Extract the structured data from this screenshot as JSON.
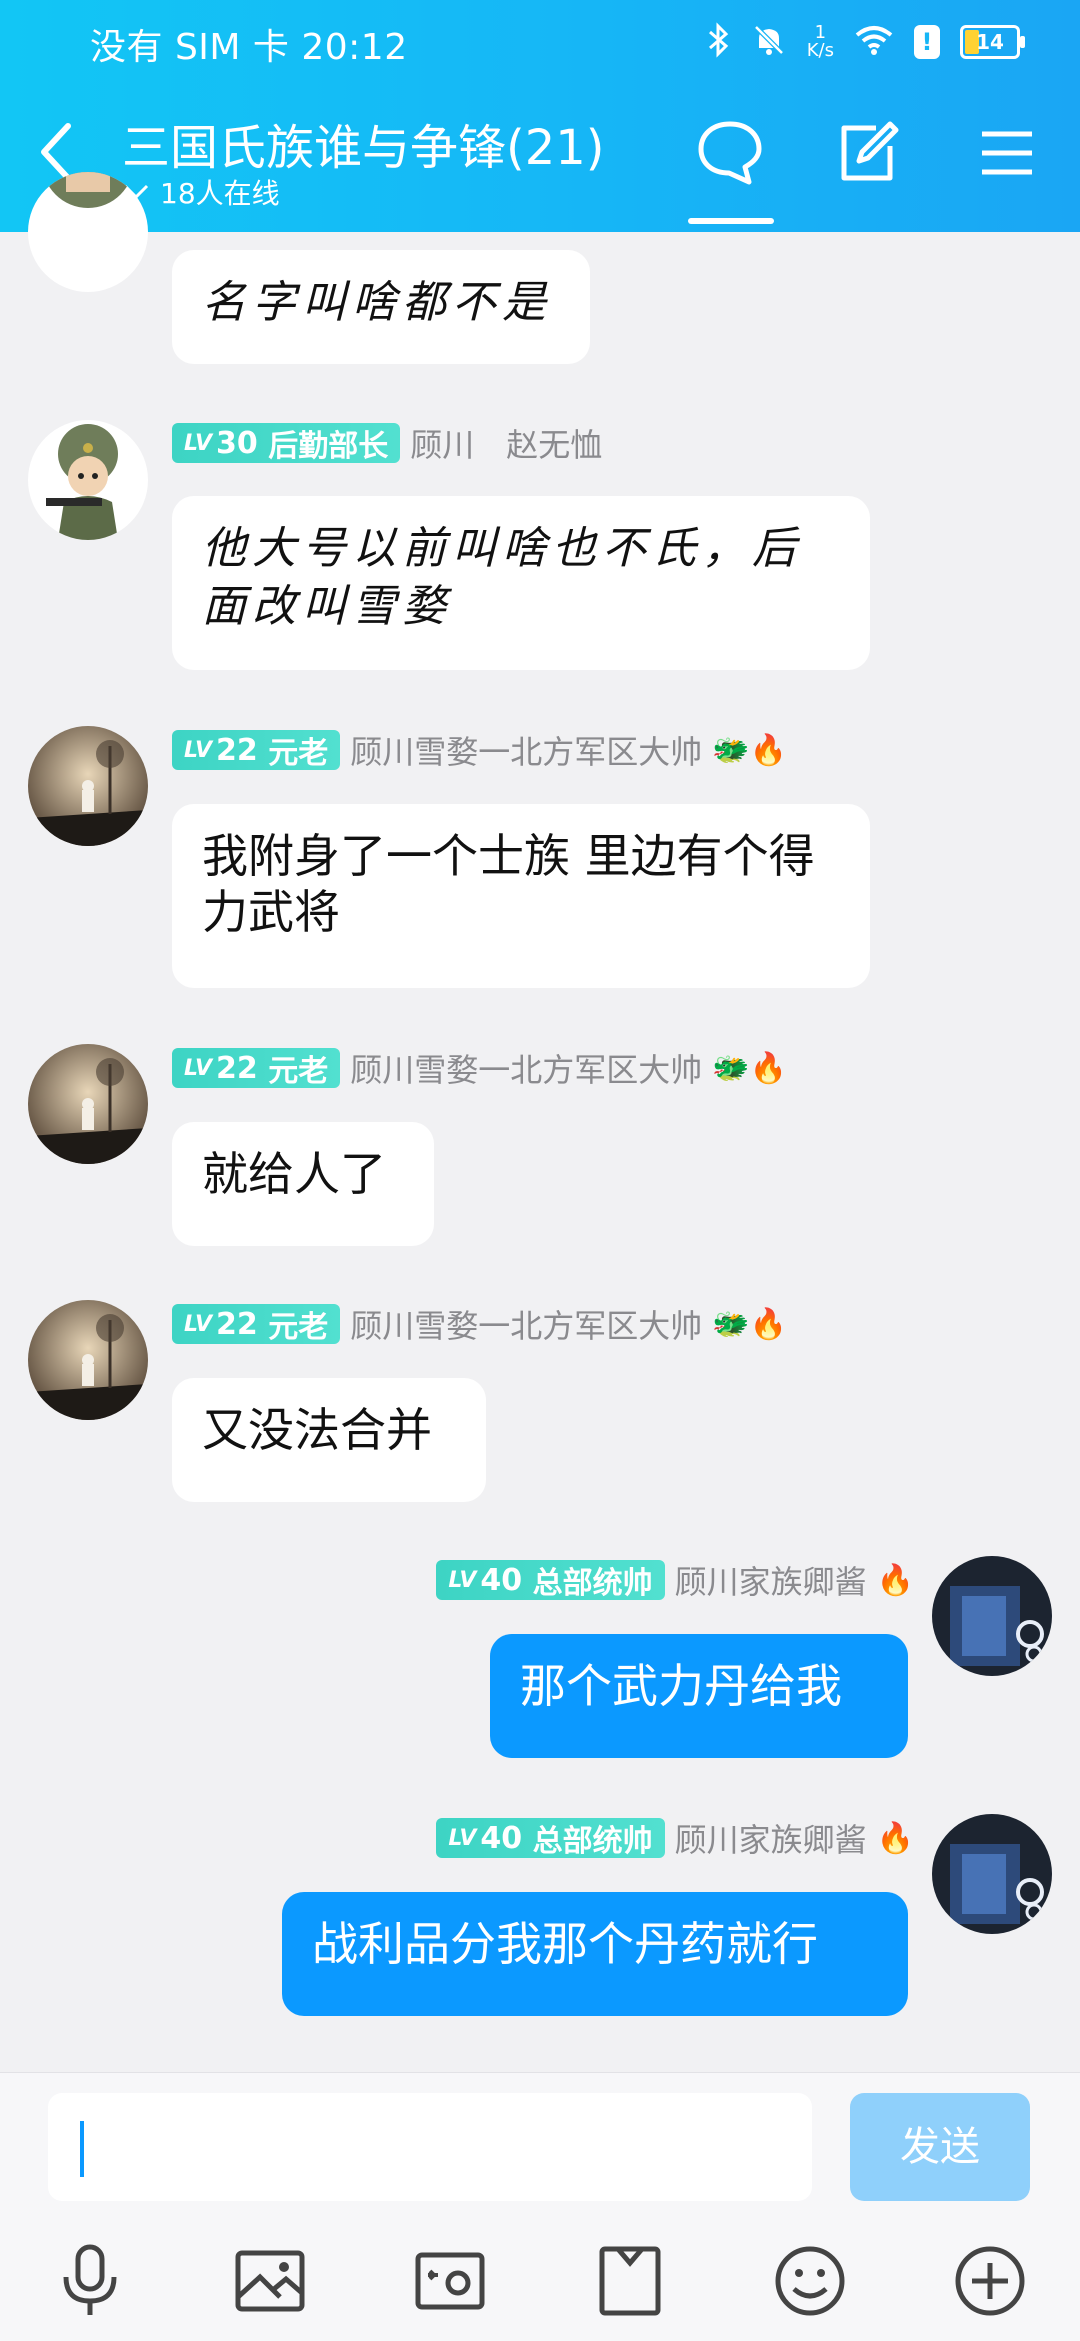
{
  "status_bar": {
    "carrier_time": "没有 SIM 卡 20:12",
    "net_speed_value": "1",
    "net_speed_unit": "K/s",
    "battery": "14",
    "icons": [
      "bluetooth-icon",
      "mute-icon",
      "wifi-icon",
      "alert-icon",
      "battery-icon"
    ]
  },
  "header": {
    "title": "三国氏族谁与争锋(21)",
    "subtitle": "18人在线",
    "icons": [
      "back-icon",
      "chat-bubble-icon",
      "edit-icon",
      "menu-icon"
    ]
  },
  "messages": [
    {
      "side": "left",
      "text": "名字叫啥都不是",
      "handwritten": true
    },
    {
      "side": "left",
      "level": "30",
      "title": "后勤部长",
      "sender": "顾川　赵无恤",
      "text": "他大号以前叫啥也不氏，后面改叫雪婺",
      "handwritten": true
    },
    {
      "side": "left",
      "level": "22",
      "title": "元老",
      "sender": "顾川雪婺一北方军区大帅",
      "emojis": "🐲🔥",
      "text": "我附身了一个士族 里边有个得力武将"
    },
    {
      "side": "left",
      "level": "22",
      "title": "元老",
      "sender": "顾川雪婺一北方军区大帅",
      "emojis": "🐲🔥",
      "text": "就给人了"
    },
    {
      "side": "left",
      "level": "22",
      "title": "元老",
      "sender": "顾川雪婺一北方军区大帅",
      "emojis": "🐲🔥",
      "text": "又没法合并"
    },
    {
      "side": "right",
      "level": "40",
      "title": "总部统帅",
      "sender": "顾川家族卿酱",
      "emojis": "🔥",
      "text": "那个武力丹给我"
    },
    {
      "side": "right",
      "level": "40",
      "title": "总部统帅",
      "sender": "顾川家族卿酱",
      "emojis": "🔥",
      "text": "战利品分我那个丹药就行"
    }
  ],
  "input_bar": {
    "placeholder": "",
    "send_label": "发送",
    "tools": [
      "microphone-icon",
      "image-icon",
      "camera-icon",
      "file-icon",
      "emoji-icon",
      "plus-icon"
    ]
  },
  "colors": {
    "header_start": "#12c6f5",
    "header_end": "#1aa6f4",
    "self_bubble": "#0b99ff",
    "badge": "#3dd4c4",
    "send_disabled": "#8fd0fb"
  }
}
